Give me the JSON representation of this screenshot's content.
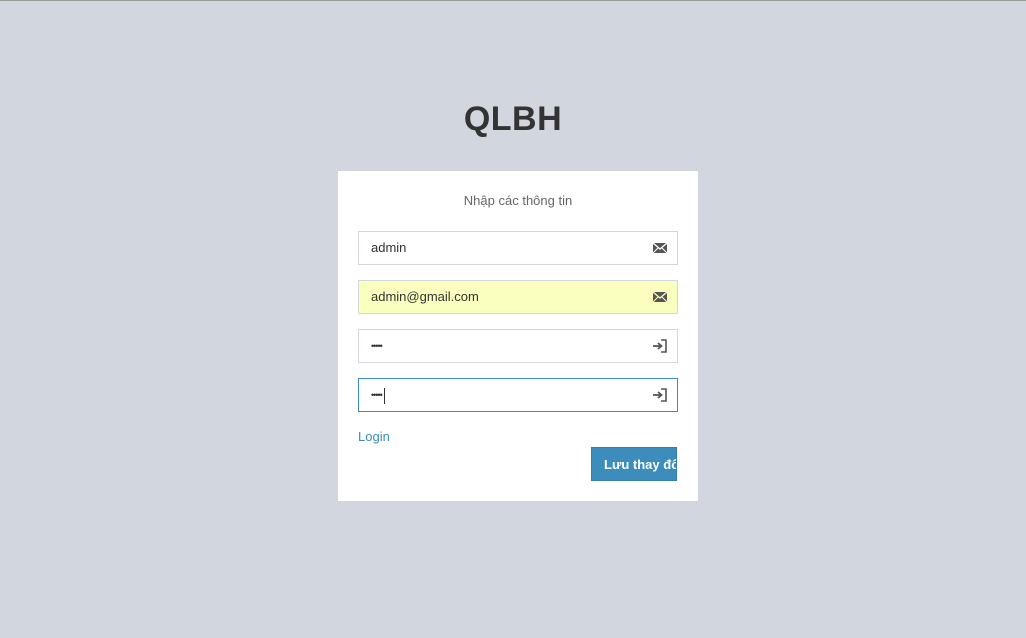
{
  "app": {
    "logo_text": "QLBH"
  },
  "form": {
    "message": "Nhập các thông tin",
    "fields": [
      {
        "name": "username",
        "value": "admin",
        "icon": "envelope-icon",
        "autofilled": false,
        "focused": false
      },
      {
        "name": "email",
        "value": "admin@gmail.com",
        "icon": "envelope-icon",
        "autofilled": true,
        "focused": false
      },
      {
        "name": "password",
        "value": "•••••",
        "icon": "sign-in-icon",
        "autofilled": false,
        "focused": false
      },
      {
        "name": "password-confirm",
        "value": "•••••",
        "icon": "sign-in-icon",
        "autofilled": false,
        "focused": true
      }
    ],
    "login_link": "Login",
    "submit_label": "Lưu thay đổi"
  },
  "colors": {
    "background": "#d2d6de",
    "primary": "#3c8dbc",
    "autofill": "#faffbd"
  }
}
